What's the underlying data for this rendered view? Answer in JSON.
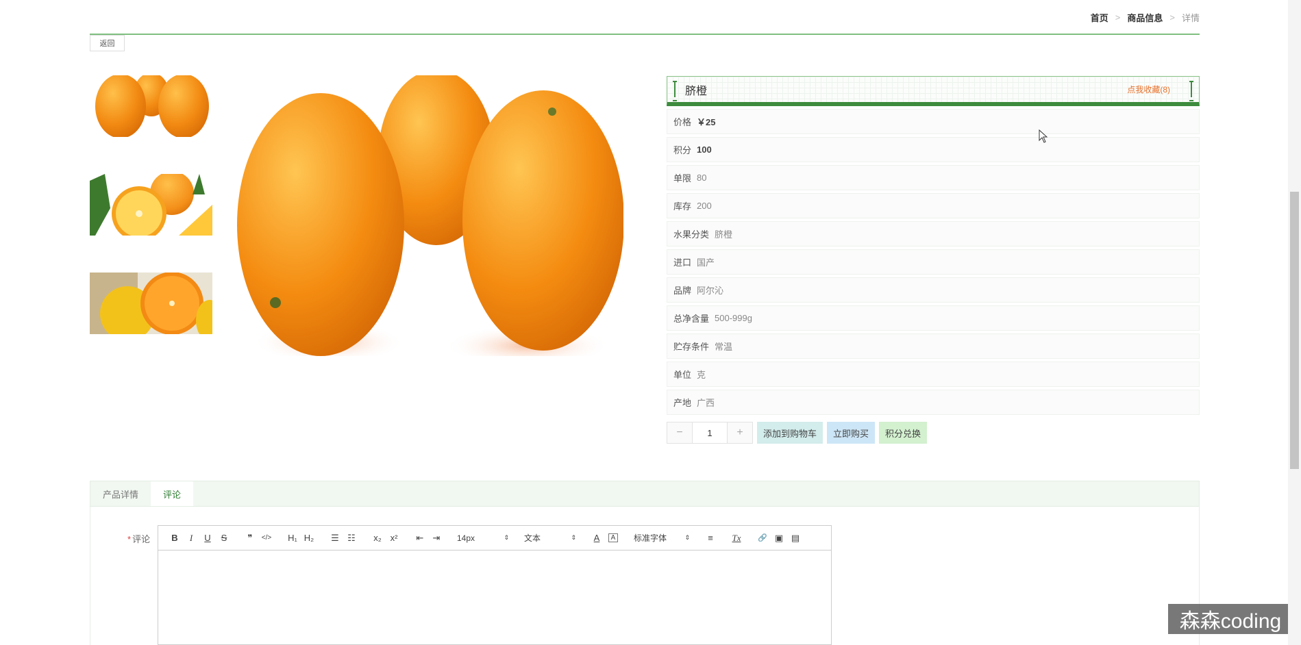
{
  "breadcrumb": {
    "home": "首页",
    "section": "商品信息",
    "current": "详情",
    "separator": ">"
  },
  "back_label": "返回",
  "product": {
    "name": "脐橙",
    "favorite_label": "点我收藏(8)",
    "attributes": [
      {
        "key": "价格",
        "value": "￥25",
        "bold": true
      },
      {
        "key": "积分",
        "value": "100",
        "bold": true
      },
      {
        "key": "单限",
        "value": "80"
      },
      {
        "key": "库存",
        "value": "200"
      },
      {
        "key": "水果分类",
        "value": "脐橙"
      },
      {
        "key": "进口",
        "value": "国产"
      },
      {
        "key": "品牌",
        "value": "阿尔沁"
      },
      {
        "key": "总净含量",
        "value": "500-999g"
      },
      {
        "key": "贮存条件",
        "value": "常温"
      },
      {
        "key": "单位",
        "value": "克"
      },
      {
        "key": "产地",
        "value": "广西"
      }
    ]
  },
  "quantity": {
    "minus": "−",
    "value": "1",
    "plus": "+"
  },
  "actions": {
    "add_to_cart": "添加到购物车",
    "buy_now": "立即购买",
    "points_exchange": "积分兑换"
  },
  "tabs": [
    {
      "label": "产品详情"
    },
    {
      "label": "评论",
      "active": true
    }
  ],
  "comment": {
    "required_mark": "*",
    "label": "评论"
  },
  "editor": {
    "bold": "B",
    "italic": "I",
    "underline": "U",
    "strike": "S",
    "quote": "❞",
    "code": "</>",
    "h1": "H₁",
    "h2": "H₂",
    "ordered_list": "☰",
    "bullet_list": "☷",
    "subscript": "x₂",
    "superscript": "x²",
    "outdent": "⇤",
    "indent": "⇥",
    "font_size": "14px",
    "text_style": "文本",
    "color": "A",
    "background": "A",
    "font_family": "标准字体",
    "align": "≡",
    "clean": "Tx",
    "link": "🔗",
    "image": "▣",
    "video": "▤",
    "select_arrow": "⇕"
  },
  "watermark": "森森coding",
  "colors": {
    "accent": "#3d8b3d",
    "favorite": "#e8702a",
    "orange": "#f08c14"
  }
}
